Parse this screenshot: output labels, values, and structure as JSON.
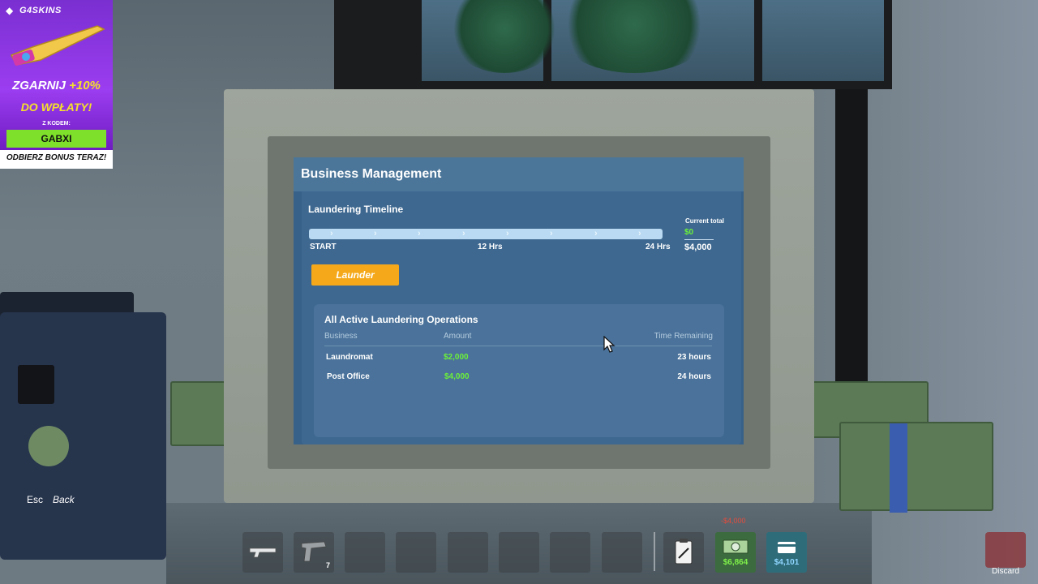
{
  "ad": {
    "brand": "G4SKINS",
    "headline_part1": "ZGARNIJ ",
    "headline_part2": "+10%",
    "headline_line2": "DO WPŁATY!",
    "code_label": "Z KODEM:",
    "code": "GABXI",
    "cta": "ODBIERZ BONUS TERAZ!",
    "colors": {
      "bg": "#8a35e0",
      "accent": "#f5e12a",
      "code_bg": "#7ee02a"
    }
  },
  "screen": {
    "title": "Business Management",
    "timeline": {
      "title": "Laundering Timeline",
      "start_label": "START",
      "mid_label": "12 Hrs",
      "end_label": "24 Hrs",
      "current_total_label": "Current total",
      "current_total_value": "$0",
      "max_value": "$4,000",
      "progress": 0
    },
    "launder_button": "Launder",
    "operations": {
      "title": "All Active Laundering Operations",
      "headers": {
        "business": "Business",
        "amount": "Amount",
        "time": "Time Remaining"
      },
      "rows": [
        {
          "business": "Laundromat",
          "amount": "$2,000",
          "time": "23 hours"
        },
        {
          "business": "Post Office",
          "amount": "$4,000",
          "time": "24 hours"
        }
      ]
    },
    "colors": {
      "screen_bg": "#38618a",
      "accent": "#f5a91a",
      "money": "#6cf03a"
    }
  },
  "hud": {
    "esc_key": "Esc",
    "esc_action": "Back",
    "hotbar": [
      {
        "icon": "pistol-icon",
        "count": ""
      },
      {
        "icon": "pistol-icon",
        "count": "7"
      },
      {
        "icon": "empty",
        "count": ""
      },
      {
        "icon": "empty",
        "count": ""
      },
      {
        "icon": "empty",
        "count": ""
      },
      {
        "icon": "empty",
        "count": ""
      },
      {
        "icon": "empty",
        "count": ""
      },
      {
        "icon": "empty",
        "count": ""
      }
    ],
    "clipboard_icon": "clipboard-icon",
    "cash_value": "$6,864",
    "cash_deduction": "-$4,000",
    "card_value": "$4,101",
    "discard_label": "Discard"
  }
}
